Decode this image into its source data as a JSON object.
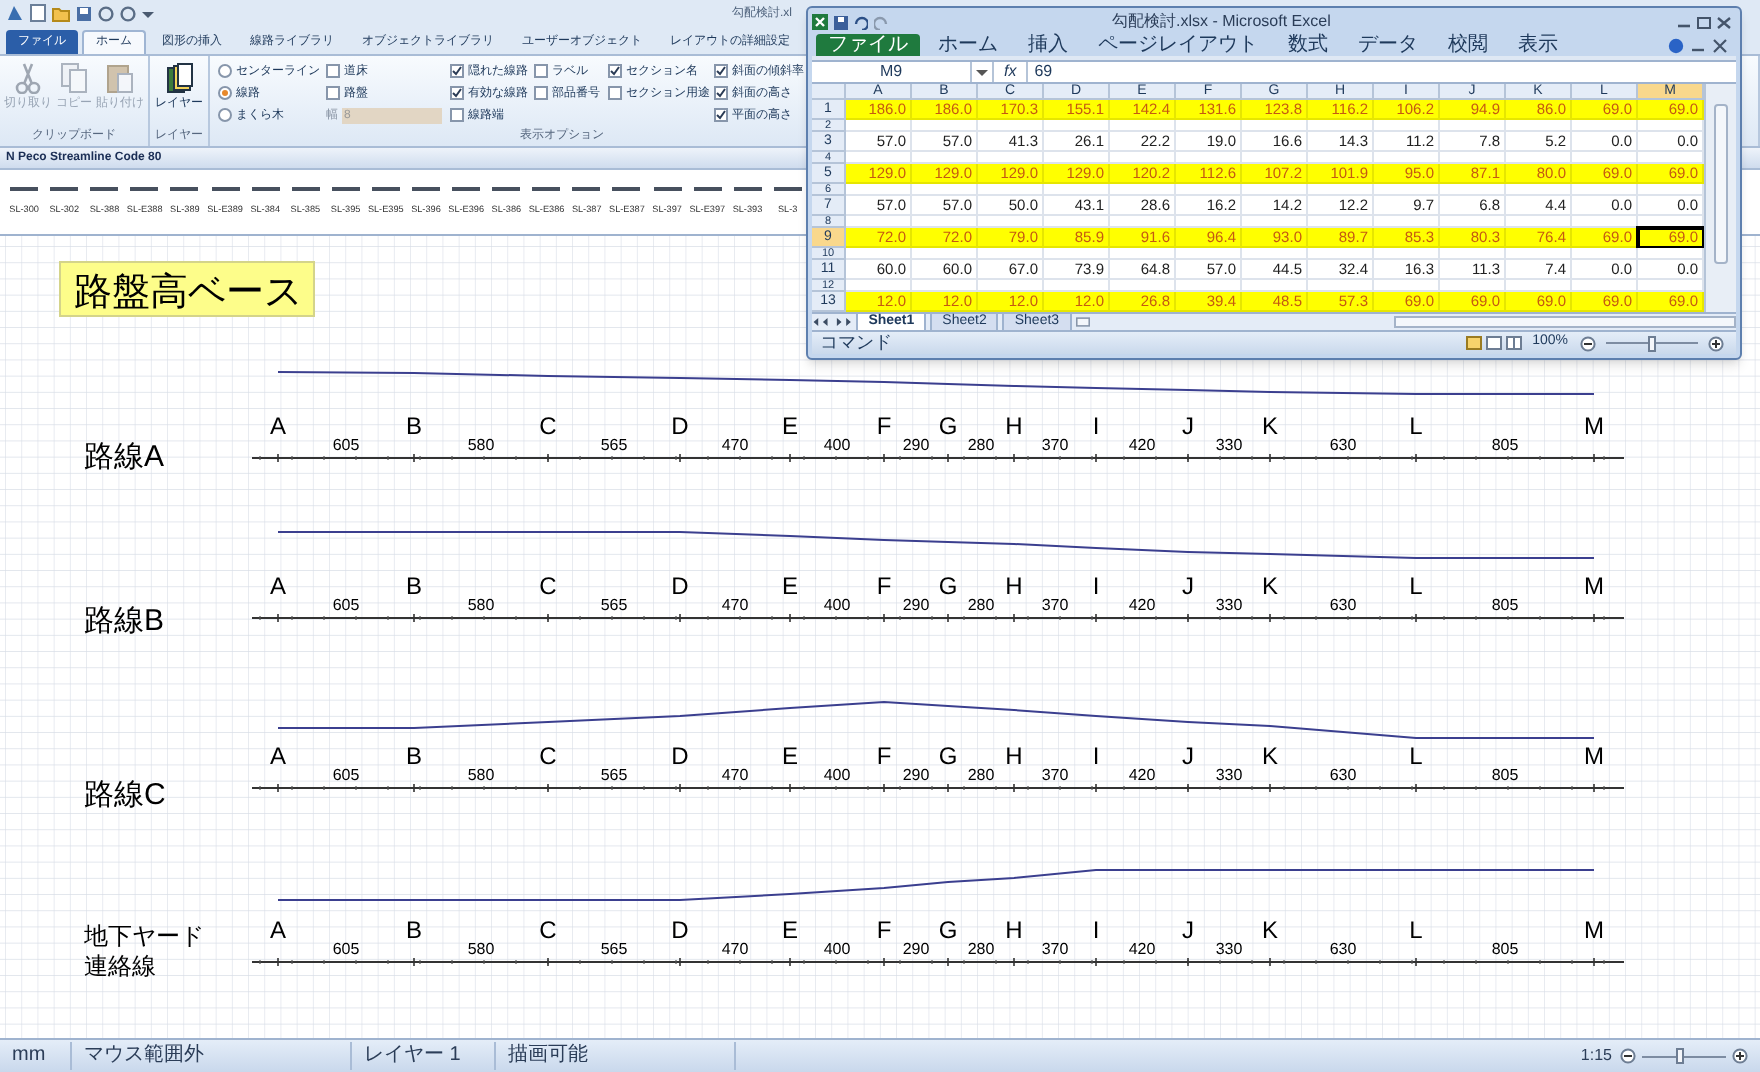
{
  "app": {
    "title": "勾配検討.xl",
    "tabs": [
      {
        "label": "ファイル",
        "kind": "file",
        "selected": false
      },
      {
        "label": "ホーム",
        "kind": "tab",
        "selected": true
      },
      {
        "label": "図形の挿入",
        "kind": "tab",
        "selected": false
      },
      {
        "label": "線路ライブラリ",
        "kind": "tab",
        "selected": false
      },
      {
        "label": "オブジェクトライブラリ",
        "kind": "tab",
        "selected": false
      },
      {
        "label": "ユーザーオブジェクト",
        "kind": "tab",
        "selected": false
      },
      {
        "label": "レイアウトの詳細設定",
        "kind": "tab",
        "selected": false
      }
    ]
  },
  "ribbon": {
    "clipboard": {
      "buttons": [
        {
          "label": "切り取り",
          "kind": "cut",
          "disabled": true
        },
        {
          "label": "コピー",
          "kind": "copy",
          "disabled": true
        },
        {
          "label": "貼り付け",
          "kind": "paste",
          "disabled": true
        }
      ],
      "group_label": "クリップボード"
    },
    "layer": {
      "button": "レイヤー",
      "group_label": "レイヤー"
    },
    "display_options": {
      "columns": [
        [
          {
            "kind": "radio",
            "label": "センターライン",
            "selected": false
          },
          {
            "kind": "radio",
            "label": "線路",
            "selected": true
          },
          {
            "kind": "radio",
            "label": "まくら木",
            "selected": false
          }
        ],
        [
          {
            "kind": "checkbox",
            "label": "道床",
            "checked": false
          },
          {
            "kind": "checkbox",
            "label": "路盤",
            "checked": false
          },
          {
            "kind": "field",
            "label": "幅",
            "value": "8",
            "disabled": true
          }
        ],
        [
          {
            "kind": "checkbox",
            "label": "隠れた線路",
            "checked": true
          },
          {
            "kind": "checkbox",
            "label": "有効な線路",
            "checked": true
          },
          {
            "kind": "checkbox",
            "label": "線路端",
            "checked": false
          }
        ],
        [
          {
            "kind": "checkbox",
            "label": "ラベル",
            "checked": false
          },
          {
            "kind": "checkbox",
            "label": "部品番号",
            "checked": false
          }
        ],
        [
          {
            "kind": "checkbox",
            "label": "セクション名",
            "checked": true
          },
          {
            "kind": "checkbox",
            "label": "セクション用途",
            "checked": false
          }
        ],
        [
          {
            "kind": "checkbox",
            "label": "斜面の傾斜率",
            "checked": true
          },
          {
            "kind": "checkbox",
            "label": "斜面の高さ",
            "checked": true
          },
          {
            "kind": "checkbox",
            "label": "平面の高さ",
            "checked": true
          }
        ]
      ],
      "group_label": "表示オプション"
    }
  },
  "library": {
    "title": "N Peco Streamline Code 80",
    "pieces": [
      "SL-300",
      "SL-302",
      "SL-388",
      "SL-E388",
      "SL-389",
      "SL-E389",
      "SL-384",
      "SL-385",
      "SL-395",
      "SL-E395",
      "SL-396",
      "SL-E396",
      "SL-386",
      "SL-E386",
      "SL-387",
      "SL-E387",
      "SL-397",
      "SL-E397",
      "SL-393",
      "SL-3"
    ]
  },
  "canvas": {
    "heading": "路盤高ベース",
    "routes": [
      {
        "name_lines": [
          "路線A"
        ],
        "stations": [
          "A",
          "B",
          "C",
          "D",
          "E",
          "F",
          "G",
          "H",
          "I",
          "J",
          "K",
          "L",
          "M"
        ],
        "distances": [
          "605",
          "580",
          "565",
          "470",
          "400",
          "290",
          "280",
          "370",
          "420",
          "330",
          "630",
          "805"
        ]
      },
      {
        "name_lines": [
          "路線B"
        ],
        "stations": [
          "A",
          "B",
          "C",
          "D",
          "E",
          "F",
          "G",
          "H",
          "I",
          "J",
          "K",
          "L",
          "M"
        ],
        "distances": [
          "605",
          "580",
          "565",
          "470",
          "400",
          "290",
          "280",
          "370",
          "420",
          "330",
          "630",
          "805"
        ]
      },
      {
        "name_lines": [
          "路線C"
        ],
        "stations": [
          "A",
          "B",
          "C",
          "D",
          "E",
          "F",
          "G",
          "H",
          "I",
          "J",
          "K",
          "L",
          "M"
        ],
        "distances": [
          "605",
          "580",
          "565",
          "470",
          "400",
          "290",
          "280",
          "370",
          "420",
          "330",
          "630",
          "805"
        ]
      },
      {
        "name_lines": [
          "地下ヤード",
          "連絡線"
        ],
        "stations": [
          "A",
          "B",
          "C",
          "D",
          "E",
          "F",
          "G",
          "H",
          "I",
          "J",
          "K",
          "L",
          "M"
        ],
        "distances": [
          "605",
          "580",
          "565",
          "470",
          "400",
          "290",
          "280",
          "370",
          "420",
          "330",
          "630",
          "805"
        ]
      }
    ]
  },
  "status_bar": {
    "items": [
      "mm",
      "マウス範囲外",
      "レイヤー 1",
      "描画可能"
    ],
    "scale": "1:15",
    "zoom_slider": {
      "level": 0.45
    }
  },
  "excel": {
    "title": "勾配検討.xlsx - Microsoft Excel",
    "tabs": [
      {
        "label": "ファイル",
        "kind": "file",
        "selected": false
      },
      {
        "label": "ホーム",
        "kind": "tab",
        "selected": false
      },
      {
        "label": "挿入",
        "kind": "tab",
        "selected": false
      },
      {
        "label": "ページレイアウト",
        "kind": "tab",
        "selected": false
      },
      {
        "label": "数式",
        "kind": "tab",
        "selected": false
      },
      {
        "label": "データ",
        "kind": "tab",
        "selected": false
      },
      {
        "label": "校閲",
        "kind": "tab",
        "selected": false
      },
      {
        "label": "表示",
        "kind": "tab",
        "selected": false
      }
    ],
    "name_box": "M9",
    "function_label": "fx",
    "formula": "69",
    "columns": [
      {
        "label": "A",
        "selected": false
      },
      {
        "label": "B",
        "selected": false
      },
      {
        "label": "C",
        "selected": false
      },
      {
        "label": "D",
        "selected": false
      },
      {
        "label": "E",
        "selected": false
      },
      {
        "label": "F",
        "selected": false
      },
      {
        "label": "G",
        "selected": false
      },
      {
        "label": "H",
        "selected": false
      },
      {
        "label": "I",
        "selected": false
      },
      {
        "label": "J",
        "selected": false
      },
      {
        "label": "K",
        "selected": false
      },
      {
        "label": "L",
        "selected": false
      },
      {
        "label": "M",
        "selected": true
      }
    ],
    "rows": [
      {
        "number": "1",
        "selected": false,
        "highlight": true,
        "cells": [
          "186.0",
          "186.0",
          "170.3",
          "155.1",
          "142.4",
          "131.6",
          "123.8",
          "116.2",
          "106.2",
          "94.9",
          "86.0",
          "69.0",
          "69.0"
        ]
      },
      {
        "number": "2",
        "selected": false,
        "highlight": false
      },
      {
        "number": "3",
        "selected": false,
        "highlight": false,
        "cells": [
          "57.0",
          "57.0",
          "41.3",
          "26.1",
          "22.2",
          "19.0",
          "16.6",
          "14.3",
          "11.2",
          "7.8",
          "5.2",
          "0.0",
          "0.0"
        ]
      },
      {
        "number": "4",
        "selected": false,
        "highlight": false
      },
      {
        "number": "5",
        "selected": false,
        "highlight": true,
        "cells": [
          "129.0",
          "129.0",
          "129.0",
          "129.0",
          "120.2",
          "112.6",
          "107.2",
          "101.9",
          "95.0",
          "87.1",
          "80.0",
          "69.0",
          "69.0"
        ]
      },
      {
        "number": "6",
        "selected": false,
        "highlight": false
      },
      {
        "number": "7",
        "selected": false,
        "highlight": false,
        "cells": [
          "57.0",
          "57.0",
          "50.0",
          "43.1",
          "28.6",
          "16.2",
          "14.2",
          "12.2",
          "9.7",
          "6.8",
          "4.4",
          "0.0",
          "0.0"
        ]
      },
      {
        "number": "8",
        "selected": false,
        "highlight": false
      },
      {
        "number": "9",
        "selected": true,
        "highlight": true,
        "cells": [
          "72.0",
          "72.0",
          "79.0",
          "85.9",
          "91.6",
          "96.4",
          "93.0",
          "89.7",
          "85.3",
          "80.3",
          "76.4",
          "69.0",
          "69.0"
        ]
      },
      {
        "number": "10",
        "selected": false,
        "highlight": false
      },
      {
        "number": "11",
        "selected": false,
        "highlight": false,
        "cells": [
          "60.0",
          "60.0",
          "67.0",
          "73.9",
          "64.8",
          "57.0",
          "44.5",
          "32.4",
          "16.3",
          "11.3",
          "7.4",
          "0.0",
          "0.0"
        ]
      },
      {
        "number": "12",
        "selected": false,
        "highlight": false
      },
      {
        "number": "13",
        "selected": false,
        "highlight": true,
        "cells": [
          "12.0",
          "12.0",
          "12.0",
          "12.0",
          "26.8",
          "39.4",
          "48.5",
          "57.3",
          "69.0",
          "69.0",
          "69.0",
          "69.0",
          "69.0"
        ]
      }
    ],
    "sheets": [
      {
        "label": "Sheet1",
        "selected": true
      },
      {
        "label": "Sheet2",
        "selected": false
      },
      {
        "label": "Sheet3",
        "selected": false
      }
    ],
    "status": "コマンド",
    "zoom": "100%",
    "zoom_slider": {
      "level": 0.5
    }
  }
}
